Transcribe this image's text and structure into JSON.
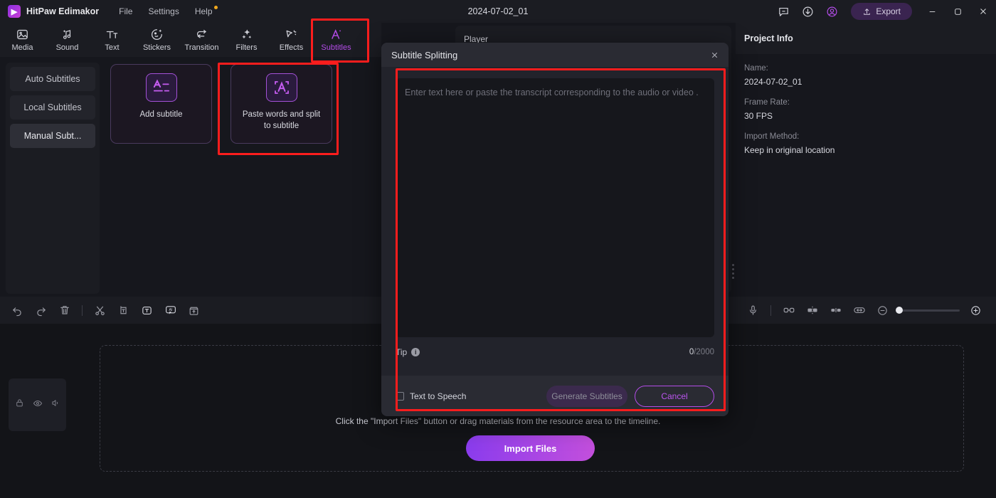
{
  "titlebar": {
    "app_name": "HitPaw Edimakor",
    "menus": [
      {
        "label": "File",
        "dot": false
      },
      {
        "label": "Settings",
        "dot": false
      },
      {
        "label": "Help",
        "dot": true
      }
    ],
    "document_title": "2024-07-02_01",
    "icons": [
      "comment-icon",
      "download-icon",
      "account-icon"
    ],
    "export_label": "Export",
    "window_controls": [
      "minimize-icon",
      "maximize-icon",
      "close-icon"
    ],
    "accent_color": "#b44ce8"
  },
  "tooltabs": [
    {
      "label": "Media",
      "icon": "media-icon",
      "active": false
    },
    {
      "label": "Sound",
      "icon": "sound-icon",
      "active": false
    },
    {
      "label": "Text",
      "icon": "text-icon",
      "active": false
    },
    {
      "label": "Stickers",
      "icon": "stickers-icon",
      "active": false
    },
    {
      "label": "Transition",
      "icon": "transition-icon",
      "active": false
    },
    {
      "label": "Filters",
      "icon": "filters-icon",
      "active": false
    },
    {
      "label": "Effects",
      "icon": "effects-icon",
      "active": false
    },
    {
      "label": "Subtitles",
      "icon": "subtitles-icon",
      "active": true
    }
  ],
  "subtitle_sidebar": [
    {
      "label": "Auto Subtitles",
      "active": false
    },
    {
      "label": "Local Subtitles",
      "active": false
    },
    {
      "label": "Manual Subt...",
      "active": true
    }
  ],
  "subtitle_cards": [
    {
      "label": "Add subtitle",
      "icon": "add-subtitle-icon"
    },
    {
      "label": "Paste words and split to subtitle",
      "icon": "paste-split-icon"
    }
  ],
  "player": {
    "label": "Player"
  },
  "project_info": {
    "heading": "Project Info",
    "fields": [
      {
        "key": "Name:",
        "value": "2024-07-02_01"
      },
      {
        "key": "Frame Rate:",
        "value": "30 FPS"
      },
      {
        "key": "Import Method:",
        "value": "Keep in original location"
      }
    ]
  },
  "timeline_toolbar": {
    "left_icons": [
      "undo-icon",
      "redo-icon",
      "delete-icon",
      "split-icon",
      "crop-icon",
      "text-box-icon",
      "ai-icon",
      "export-clip-icon"
    ],
    "right_icons": [
      "microphone-icon",
      "link-icon",
      "align-center-icon",
      "align-split-icon",
      "fit-width-icon"
    ],
    "zoom_out": "zoom-out-icon",
    "zoom_in": "zoom-in-icon"
  },
  "timeline": {
    "track_icons": [
      "lock-icon",
      "eye-icon",
      "speaker-icon"
    ],
    "hint": "Click the \"Import Files\" button or drag materials from the resource area to the timeline.",
    "import_button": "Import Files"
  },
  "modal": {
    "title": "Subtitle Splitting",
    "close_icon": "close-icon",
    "textarea_placeholder": "Enter text here or paste the transcript corresponding to the audio or video .",
    "textarea_value": "",
    "tip_label": "Tip",
    "info_icon": "info-icon",
    "char_count": "0",
    "char_max": "/2000",
    "checkbox_label": "Text to Speech",
    "checkbox_checked": false,
    "generate_button": "Generate Subtitles",
    "cancel_button": "Cancel"
  },
  "highlights": {
    "color": "#fb1d1d",
    "regions": [
      "subtitles-tab",
      "paste-split-card",
      "subtitle-splitting-dialog"
    ]
  }
}
